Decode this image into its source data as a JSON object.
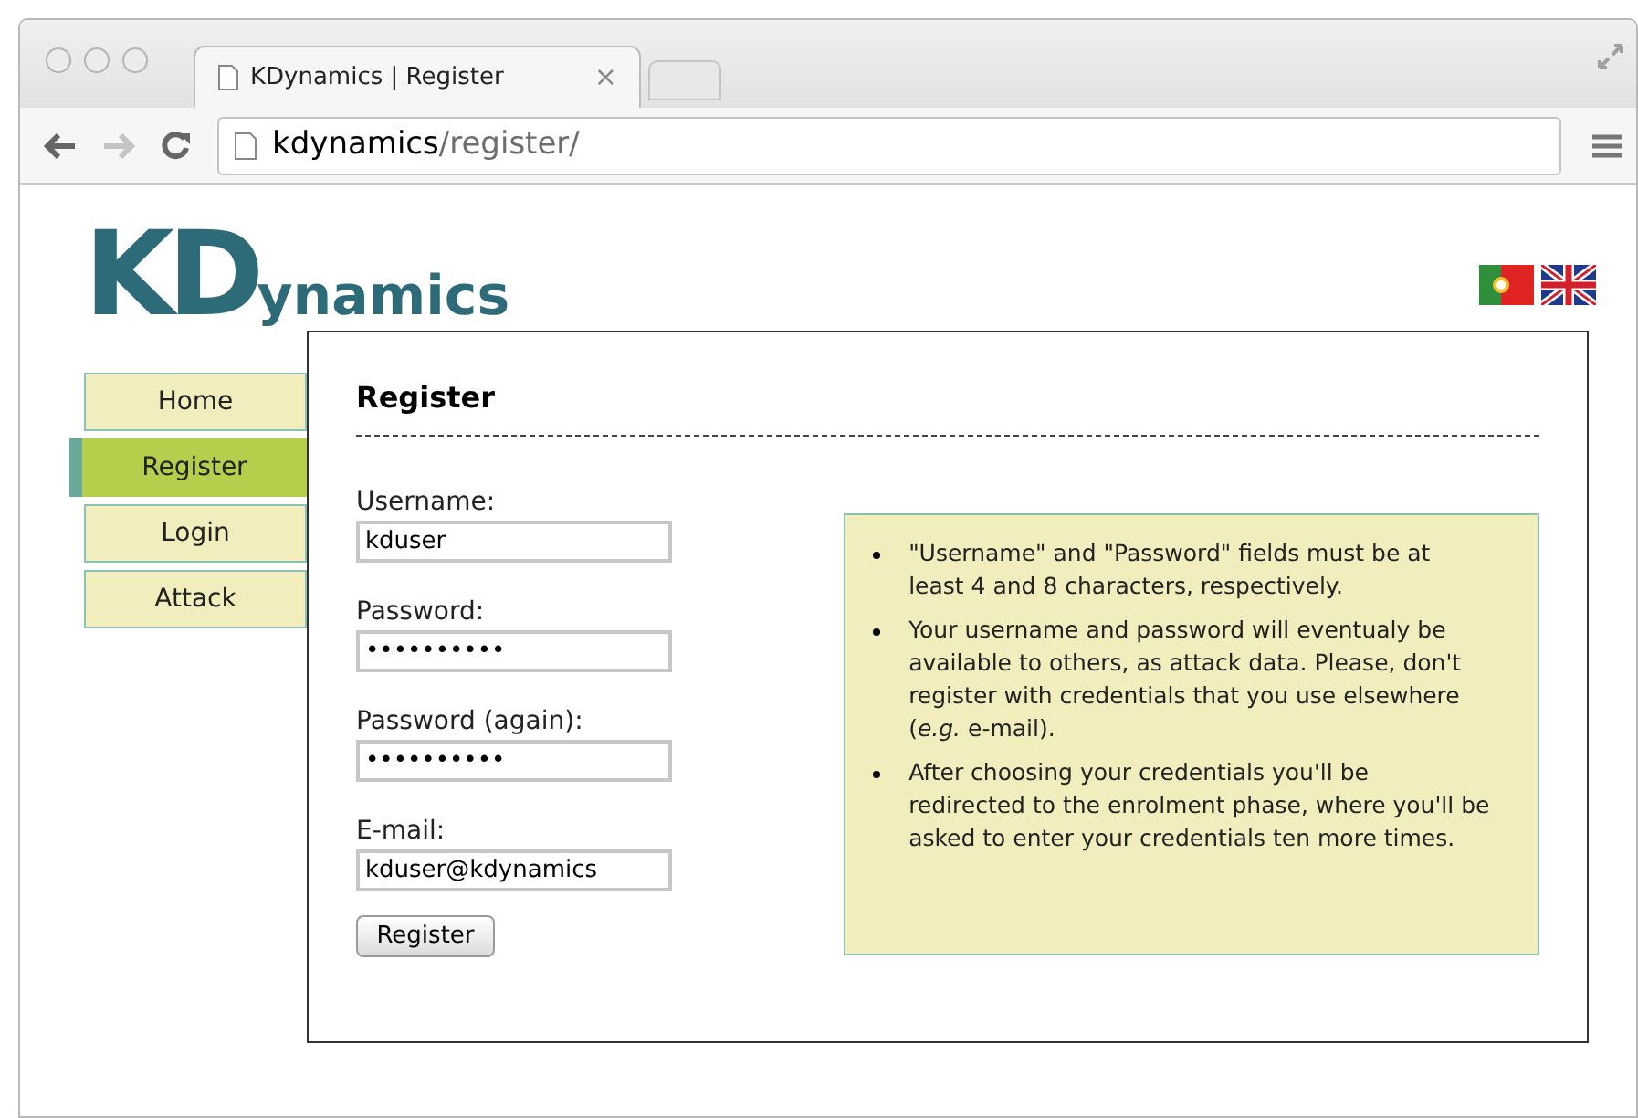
{
  "browser": {
    "tab_title": "KDynamics | Register",
    "tab_close": "×",
    "url_host": "kdynamics",
    "url_path": "/register/"
  },
  "logo": {
    "big": "KD",
    "rest": "ynamics"
  },
  "languages": [
    {
      "kind": "pt"
    },
    {
      "kind": "uk"
    }
  ],
  "nav": [
    {
      "label": "Home",
      "selected": false
    },
    {
      "label": "Register",
      "selected": true
    },
    {
      "label": "Login",
      "selected": false
    },
    {
      "label": "Attack",
      "selected": false
    }
  ],
  "form": {
    "title": "Register",
    "fields": [
      {
        "label": "Username:",
        "value": "kduser"
      },
      {
        "label": "Password:",
        "value": "••••••••••"
      },
      {
        "label": "Password (again):",
        "value": "••••••••••"
      },
      {
        "label": "E-mail:",
        "value": "kduser@kdynamics"
      }
    ],
    "submit": "Register"
  },
  "notes": [
    "\"Username\" and \"Password\" fields must be at least 4 and 8 characters, respectively.",
    "Your username and password will eventualy be available to others, as attack data. Please, don't register with credentials that you use elsewhere (*e.g.* e-mail).",
    "After choosing your credentials you'll be redirected to the enrolment phase, where you'll be asked to enter your credentials ten more times."
  ]
}
